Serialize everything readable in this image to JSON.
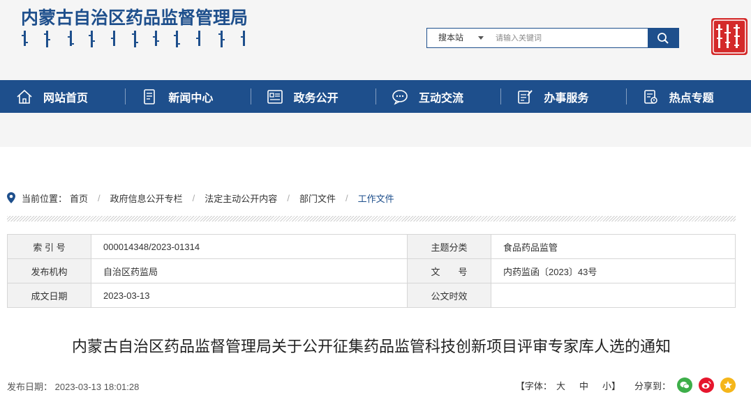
{
  "header": {
    "site_title": "内蒙古自治区药品监督管理局",
    "search": {
      "scope_selected": "搜本站",
      "placeholder": "请输入关键词",
      "value": ""
    }
  },
  "nav": {
    "items": [
      {
        "label": "网站首页",
        "icon": "home-icon"
      },
      {
        "label": "新闻中心",
        "icon": "news-icon"
      },
      {
        "label": "政务公开",
        "icon": "gov-open-icon"
      },
      {
        "label": "互动交流",
        "icon": "chat-icon"
      },
      {
        "label": "办事服务",
        "icon": "service-icon"
      },
      {
        "label": "热点专题",
        "icon": "topic-icon"
      }
    ]
  },
  "breadcrumb": {
    "prefix": "当前位置：",
    "items": [
      "首页",
      "政府信息公开专栏",
      "法定主动公开内容",
      "部门文件",
      "工作文件"
    ]
  },
  "info": {
    "index_label": "索 引 号",
    "index_value": "000014348/2023-01314",
    "topic_label": "主题分类",
    "topic_value": "食品药品监管",
    "publisher_label": "发布机构",
    "publisher_value": "自治区药监局",
    "docno_label": "文　　号",
    "docno_value": "内药监函〔2023〕43号",
    "date_label": "成文日期",
    "date_value": "2023-03-13",
    "validity_label": "公文时效",
    "validity_value": ""
  },
  "article": {
    "title": "内蒙古自治区药品监督管理局关于公开征集药品监管科技创新项目评审专家库人选的通知",
    "publish_prefix": "发布日期：",
    "publish_time": "2023-03-13 18:01:28",
    "font_label": "【字体：",
    "font_large": "大",
    "font_medium": "中",
    "font_small": "小】",
    "share_label": "分享到："
  },
  "colors": {
    "brand": "#1e4f8c",
    "seal": "#d42a2a",
    "wechat": "#3dae49",
    "weibo": "#e6162d",
    "qzone": "#f5b61a"
  }
}
